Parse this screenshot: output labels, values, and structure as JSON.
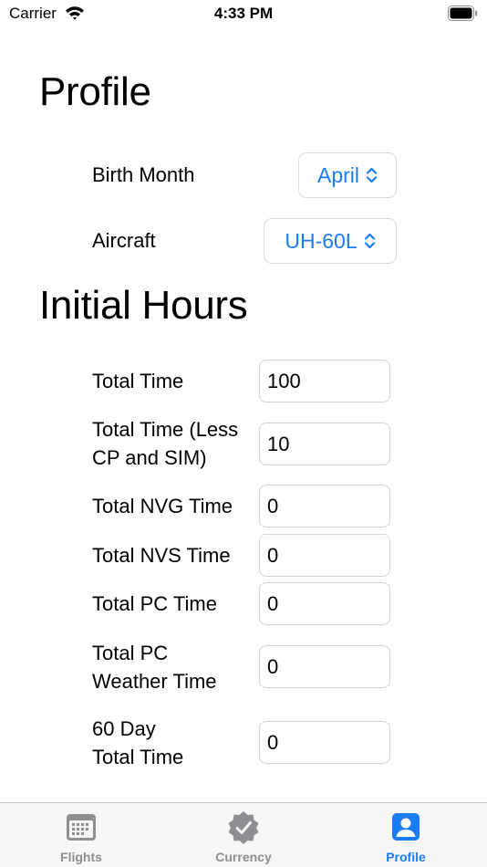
{
  "status_bar": {
    "carrier": "Carrier",
    "time": "4:33 PM"
  },
  "profile": {
    "title": "Profile",
    "birth_month": {
      "label": "Birth Month",
      "value": "April"
    },
    "aircraft": {
      "label": "Aircraft",
      "value": "UH-60L"
    }
  },
  "initial_hours": {
    "title": "Initial Hours",
    "fields": [
      {
        "label": "Total Time",
        "value": "100"
      },
      {
        "label": "Total Time (Less CP and SIM)",
        "value": "10"
      },
      {
        "label": "Total NVG Time",
        "value": "0"
      },
      {
        "label": "Total NVS Time",
        "value": "0"
      },
      {
        "label": "Total PC Time",
        "value": "0"
      },
      {
        "label": "Total PC Weather Time",
        "value": "0"
      },
      {
        "label": "60 Day Total Time",
        "value": "0"
      }
    ]
  },
  "tab_bar": {
    "tabs": [
      {
        "label": "Flights",
        "icon": "calendar-icon"
      },
      {
        "label": "Currency",
        "icon": "checkmark-seal-icon"
      },
      {
        "label": "Profile",
        "icon": "person-icon",
        "active": true
      }
    ]
  },
  "colors": {
    "accent": "#1a7cf2",
    "inactive_tab": "#8e8e93",
    "tab_bar_bg": "#f7f7f7"
  }
}
